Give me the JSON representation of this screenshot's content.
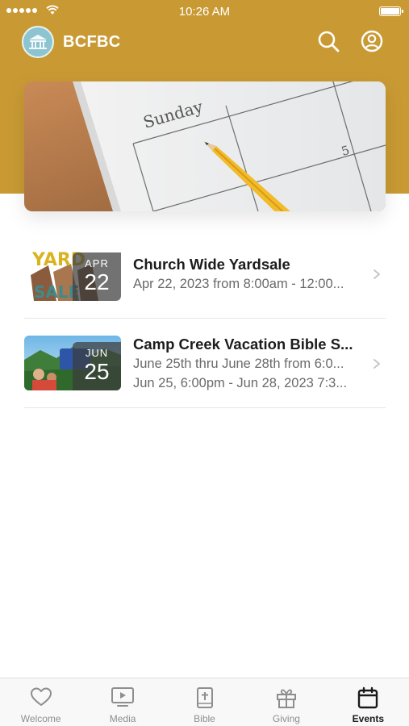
{
  "status_bar": {
    "time": "10:26 AM"
  },
  "header": {
    "title": "BCFBC"
  },
  "hero": {
    "calendar_day": "Sunday",
    "calendar_number": "5"
  },
  "events": [
    {
      "title": "Church Wide Yardsale",
      "lines": [
        "Apr 22, 2023 from 8:00am - 12:00..."
      ],
      "badge": {
        "month": "APR",
        "day": "22"
      },
      "thumb_text": [
        "YARD",
        "SALE"
      ]
    },
    {
      "title": "Camp Creek Vacation Bible S...",
      "lines": [
        "June 25th thru June 28th from 6:0...",
        "Jun 25, 6:00pm - Jun 28, 2023 7:3..."
      ],
      "badge": {
        "month": "JUN",
        "day": "25"
      }
    }
  ],
  "tabs": [
    {
      "label": "Welcome",
      "icon": "heart-icon",
      "active": false
    },
    {
      "label": "Media",
      "icon": "tv-play-icon",
      "active": false
    },
    {
      "label": "Bible",
      "icon": "bible-icon",
      "active": false
    },
    {
      "label": "Giving",
      "icon": "gift-icon",
      "active": false
    },
    {
      "label": "Events",
      "icon": "calendar-icon",
      "active": true
    }
  ],
  "colors": {
    "brand": "#c99a34",
    "active_tab": "#1a1a1a",
    "inactive_tab": "#8e8e8e"
  }
}
